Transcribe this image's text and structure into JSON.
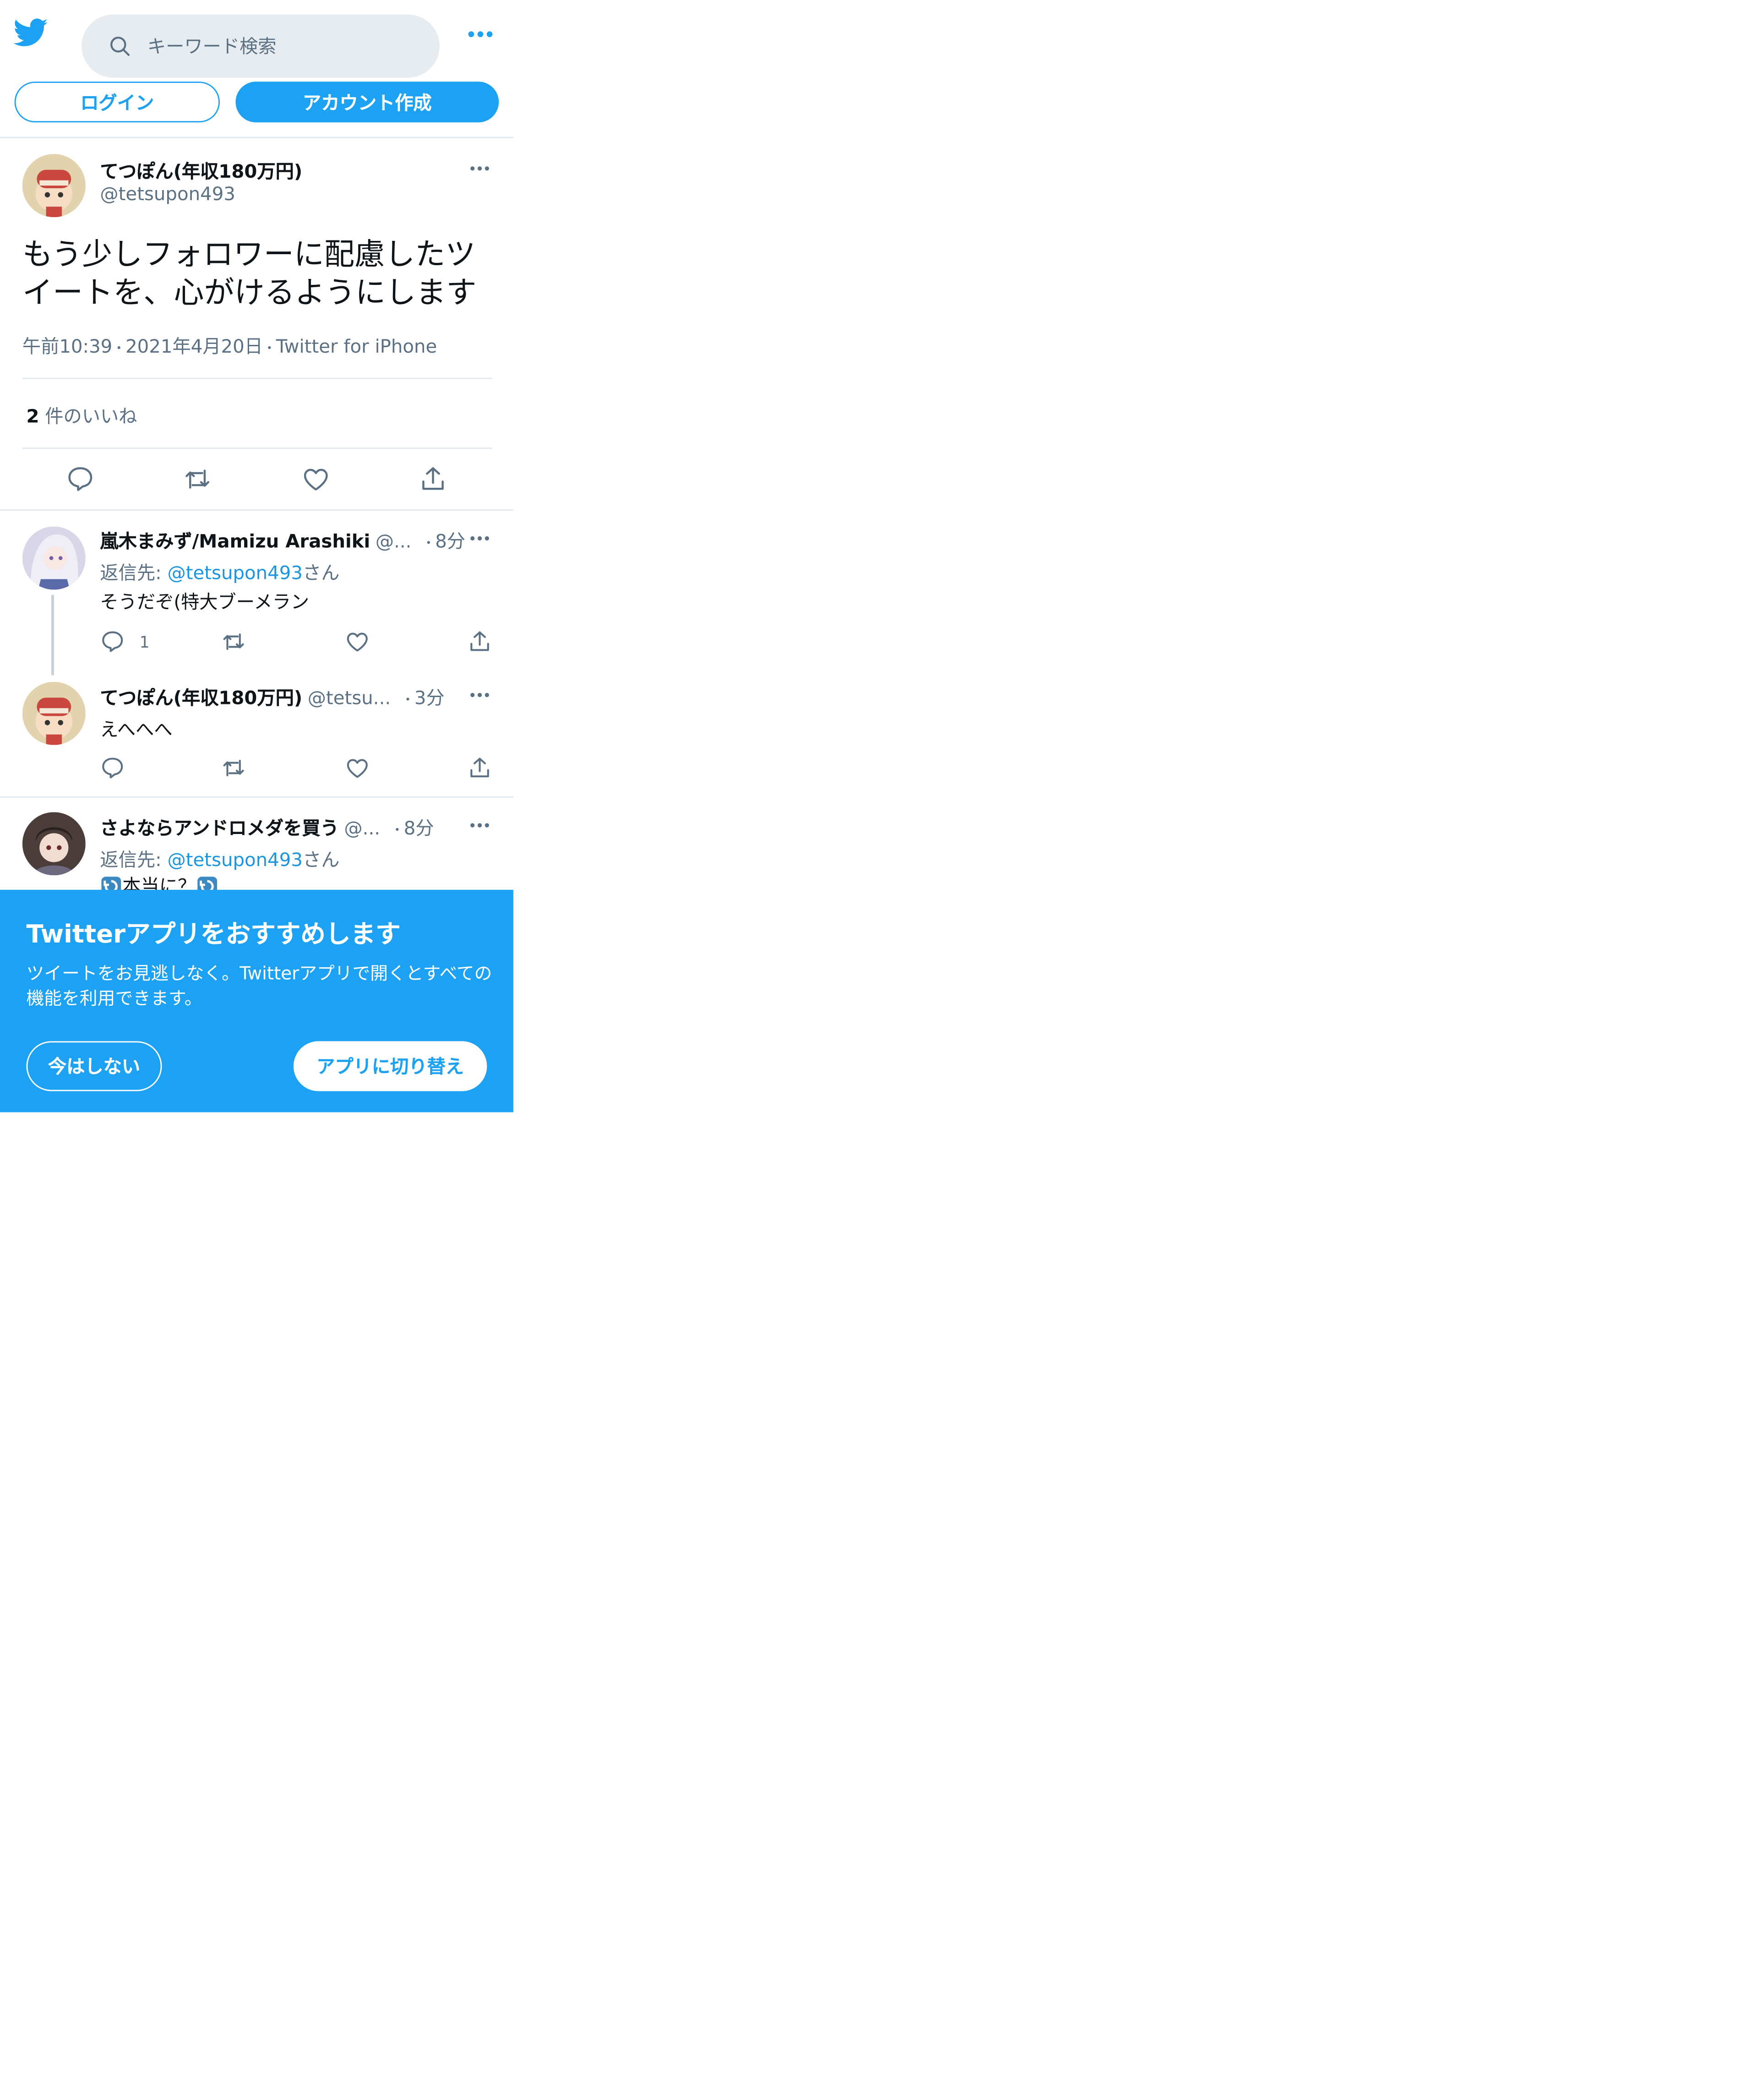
{
  "colors": {
    "accent": "#1da1f2",
    "link": "#1b95e0",
    "muted": "#5b7083",
    "divider": "#e1e8ed"
  },
  "header": {
    "search_placeholder": "キーワード検索",
    "login_label": "ログイン",
    "signup_label": "アカウント作成"
  },
  "main_tweet": {
    "name": "てつぽん(年収180万円)",
    "handle": "@tetsupon493",
    "text_line1": "もう少しフォロワーに配慮したツ",
    "text_line2": "イートを、心がけるようにします",
    "time": "午前10:39",
    "date": "2021年4月20日",
    "source": "Twitter for iPhone",
    "likes_count": "2",
    "likes_label": "件のいいね"
  },
  "replies": [
    {
      "name": "嵐木まみず/Mamizu Arashiki",
      "handle": "@...",
      "time": "8分",
      "reply_to_label": "返信先: ",
      "reply_to_handle": "@tetsupon493",
      "reply_to_suffix": "さん",
      "text": "そうだぞ(特大ブーメラン",
      "reply_count": "1"
    },
    {
      "name": "てつぽん(年収180万円)",
      "handle": "@tetsu...",
      "time": "3分",
      "text": "えへへへ"
    },
    {
      "name": "さよならアンドロメダを買う",
      "handle": "@...",
      "time": "8分",
      "reply_to_label": "返信先: ",
      "reply_to_handle": "@tetsupon493",
      "reply_to_suffix": "さん",
      "text": "本当に？"
    }
  ],
  "dot": "・",
  "banner": {
    "title": "Twitterアプリをおすすめします",
    "description": "ツイートをお見逃しなく。Twitterアプリで開くとすべての機能を利用できます。",
    "later_label": "今はしない",
    "switch_label": "アプリに切り替え"
  }
}
